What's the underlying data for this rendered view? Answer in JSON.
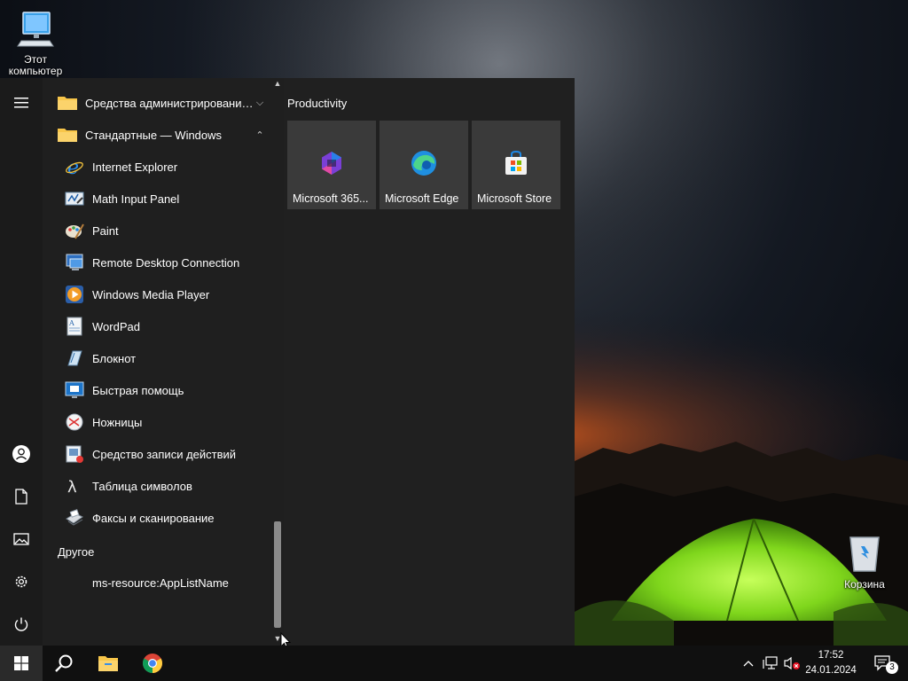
{
  "desktop": {
    "this_pc_label": "Этот компьютер",
    "recycle_bin_label": "Корзина"
  },
  "start_menu": {
    "folders": [
      {
        "label": "Средства администрирования W...",
        "chevron": "chevron-down-icon"
      },
      {
        "label": "Стандартные — Windows",
        "chevron": "chevron-up-icon"
      }
    ],
    "apps": [
      {
        "label": "Internet Explorer",
        "icon": "internet-explorer-icon"
      },
      {
        "label": "Math Input Panel",
        "icon": "math-input-panel-icon"
      },
      {
        "label": "Paint",
        "icon": "paint-icon"
      },
      {
        "label": "Remote Desktop Connection",
        "icon": "remote-desktop-icon"
      },
      {
        "label": "Windows Media Player",
        "icon": "media-player-icon"
      },
      {
        "label": "WordPad",
        "icon": "wordpad-icon"
      },
      {
        "label": "Блокнот",
        "icon": "notepad-icon"
      },
      {
        "label": "Быстрая помощь",
        "icon": "quick-assist-icon"
      },
      {
        "label": "Ножницы",
        "icon": "snipping-tool-icon"
      },
      {
        "label": "Средство записи действий",
        "icon": "steps-recorder-icon"
      },
      {
        "label": "Таблица символов",
        "icon": "character-map-icon"
      },
      {
        "label": "Факсы и сканирование",
        "icon": "fax-scan-icon"
      }
    ],
    "other_group": {
      "header": "Другое",
      "items": [
        {
          "label": "ms-resource:AppListName"
        }
      ]
    },
    "tiles_group": {
      "header": "Productivity",
      "tiles": [
        {
          "label": "Microsoft 365...",
          "icon": "microsoft-365-icon"
        },
        {
          "label": "Microsoft Edge",
          "icon": "edge-icon"
        },
        {
          "label": "Microsoft Store",
          "icon": "store-icon"
        }
      ]
    }
  },
  "taskbar": {
    "time": "17:52",
    "date": "24.01.2024",
    "notification_count": "3"
  },
  "colors": {
    "menu_bg": "#202020",
    "tile_bg": "#3a3a3a",
    "taskbar_bg": "#101010",
    "folder_yellow": "#f8c64a",
    "windows_blue": "#0078d4"
  }
}
